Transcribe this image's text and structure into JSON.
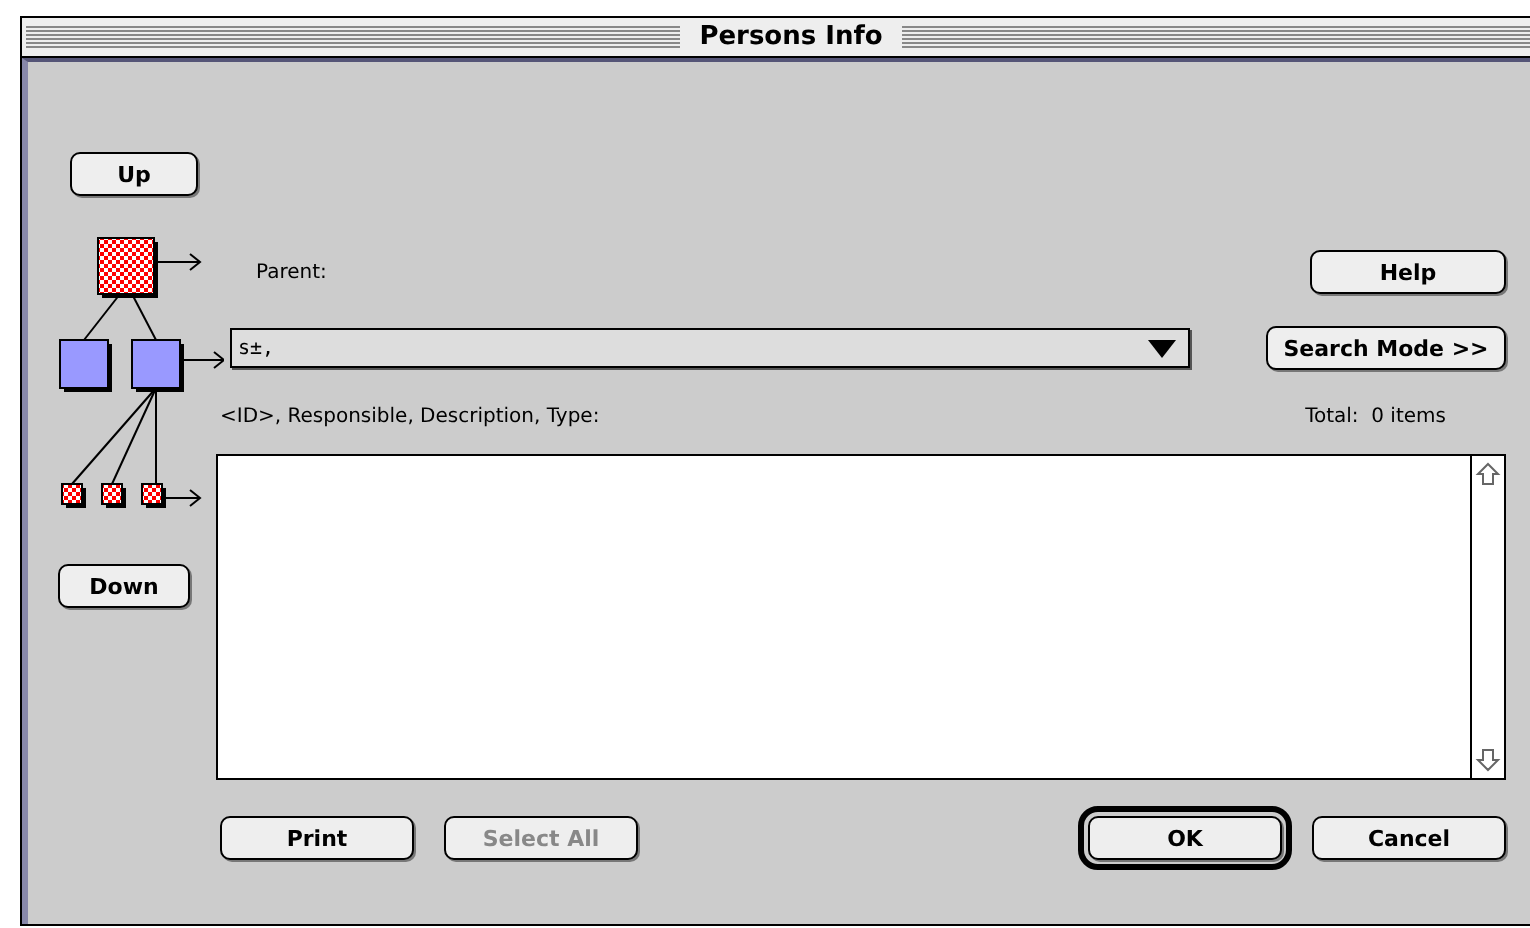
{
  "window": {
    "title": "Persons Info"
  },
  "navigation": {
    "up": "Up",
    "down": "Down"
  },
  "parent_label": "Parent:",
  "help_button": "Help",
  "parent_dropdown": {
    "value": "s±,"
  },
  "search_mode_button": "Search Mode >>",
  "list_header": "<ID>, Responsible, Description, Type:",
  "total": "Total:  0 items",
  "buttons": [
    {
      "label": "Print",
      "disabled": false,
      "default": false
    },
    {
      "label": "Select All",
      "disabled": true,
      "default": false
    },
    {
      "label": "OK",
      "disabled": false,
      "default": true
    },
    {
      "label": "Cancel",
      "disabled": false,
      "default": false
    }
  ]
}
